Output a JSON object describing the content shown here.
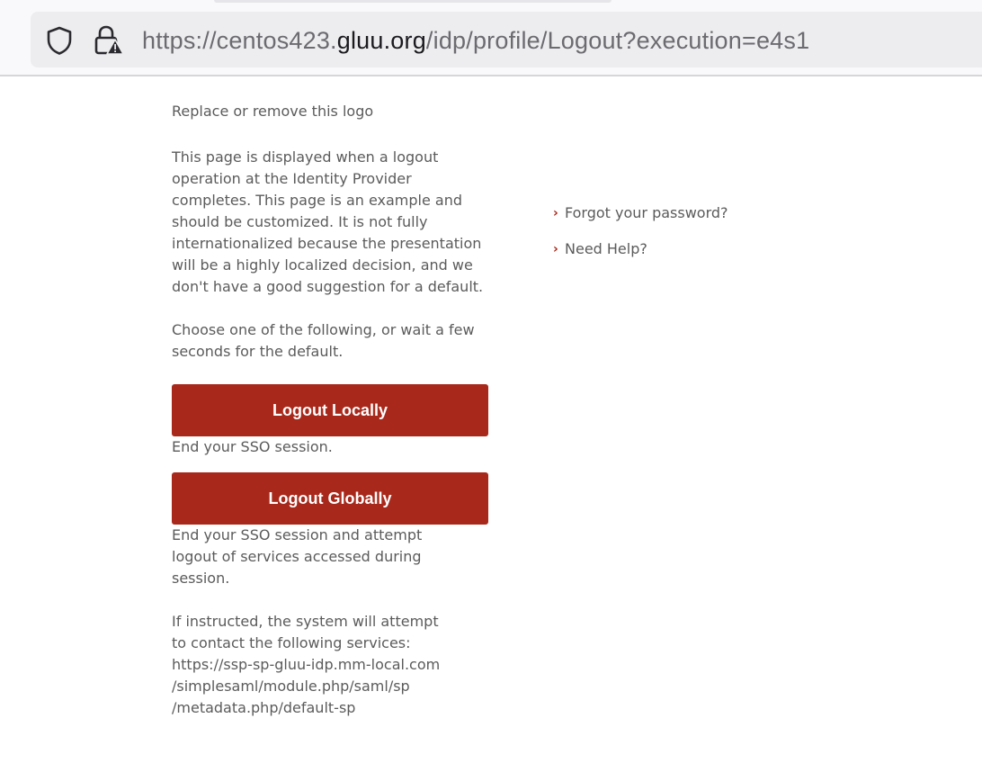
{
  "browser": {
    "url_prefix": "https://centos423.",
    "url_domain": "gluu.org",
    "url_path": "/idp/profile/Logout?execution=e4s1",
    "icons": [
      "shield-icon",
      "lock-warning-icon"
    ]
  },
  "main": {
    "logo_placeholder": "Replace or remove this logo",
    "intro_lines": [
      "This page is displayed when a logout",
      "operation at the Identity Provider",
      "completes. This page is an example and",
      "should be customized. It is not fully",
      "internationalized because the presentation",
      "will be a highly localized decision, and we",
      "don't have a good suggestion for a default."
    ],
    "choose_lines": [
      "Choose one of the following, or wait a few",
      "seconds for the default."
    ],
    "logout_locally_label": "Logout Locally",
    "logout_locally_desc": "End your SSO session.",
    "logout_globally_label": "Logout Globally",
    "logout_globally_desc_lines": [
      "End your SSO session and attempt",
      "logout of services accessed during",
      "session."
    ],
    "services_lines": [
      "If instructed, the system will attempt",
      "to contact the following services:",
      "https://ssp-sp-gluu-idp.mm-local.com",
      "/simplesaml/module.php/saml/sp",
      "/metadata.php/default-sp"
    ]
  },
  "sidebar": {
    "forgot_password": "Forgot your password?",
    "need_help": "Need Help?",
    "bullet": "›"
  },
  "colors": {
    "button": "#a8291b",
    "bullet": "#a8291b",
    "text": "#5b5b5b"
  }
}
